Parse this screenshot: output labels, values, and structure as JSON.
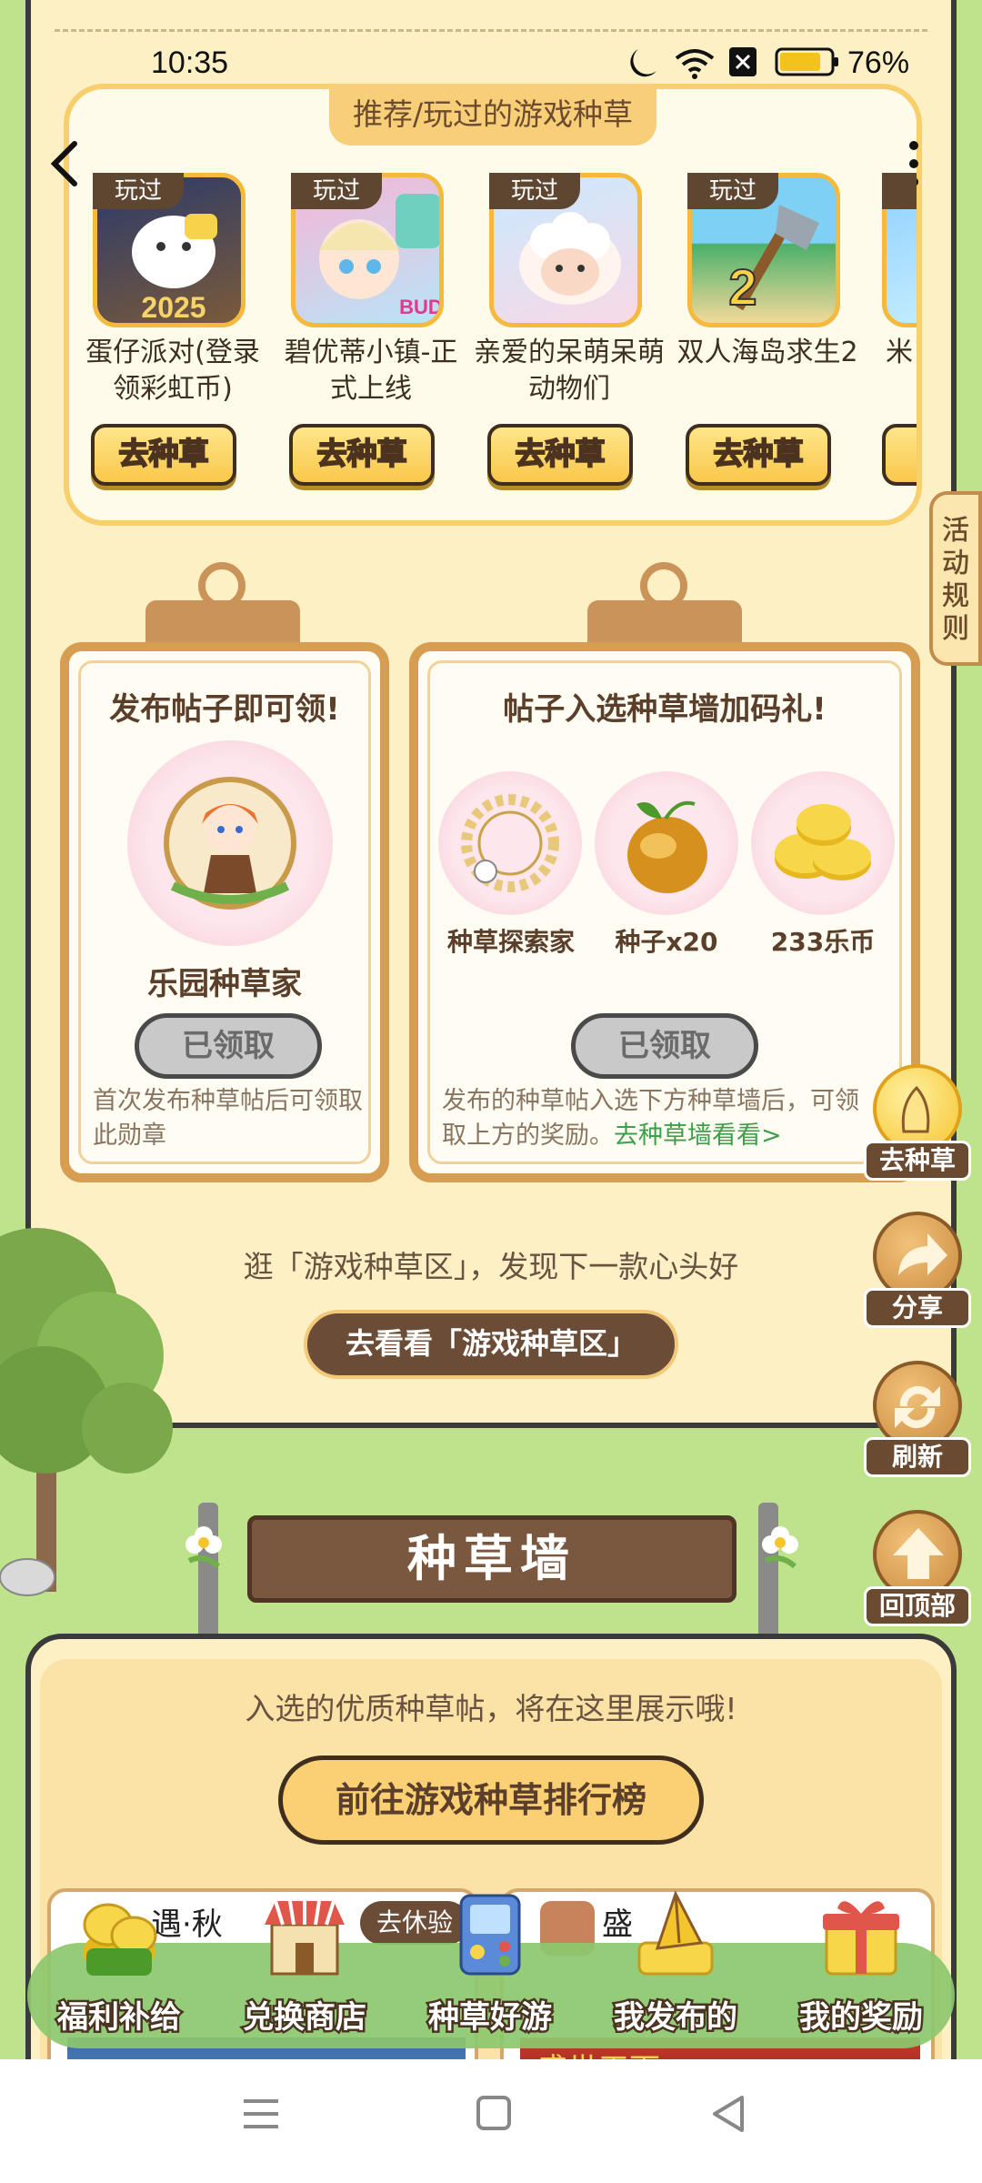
{
  "status_bar": {
    "time": "10:35",
    "battery": "76%"
  },
  "recommended": {
    "title": "推荐/玩过的游戏种草",
    "played_tag": "玩过",
    "go_label": "去种草",
    "games": [
      {
        "name": "蛋仔派对(登录领彩虹币)"
      },
      {
        "name": "碧优蒂小镇-正式上线"
      },
      {
        "name": "亲爱的呆萌呆萌动物们"
      },
      {
        "name": "双人海岛求生2"
      },
      {
        "name": "米"
      }
    ]
  },
  "rules_tab": {
    "label": "活动规则"
  },
  "reward_left": {
    "title": "发布帖子即可领!",
    "reward_name": "乐园种草家",
    "button": "已领取",
    "note": "首次发布种草帖后可领取此勋章"
  },
  "reward_right": {
    "title": "帖子入选种草墙加码礼!",
    "rewards": [
      "种草探索家",
      "种子x20",
      "233乐币"
    ],
    "button": "已领取",
    "note": "发布的种草帖入选下方种草墙后，可领取上方的奖励。",
    "link": "去种草墙看看>"
  },
  "float_buttons": [
    "去种草",
    "分享",
    "刷新",
    "回顶部"
  ],
  "explore": {
    "text": "逛「游戏种草区」，发现下一款心头好",
    "button": "去看看「游戏种草区」"
  },
  "wall": {
    "title": "种草墙",
    "desc": "入选的优质种草帖，将在这里展示哦!",
    "rank_button": "前往游戏种草排行榜"
  },
  "post_preview": {
    "left_title": "遇·秋",
    "left_chip": "去休验",
    "right_title": "盛",
    "right_banner": "盛世天下"
  },
  "bottom_nav": [
    "福利补给",
    "兑换商店",
    "种草好游",
    "我发布的",
    "我的奖励"
  ],
  "colors": {
    "cream": "#fdf0c4",
    "brown": "#6b4c37",
    "gold": "#f9c84a",
    "green": "#bfe38c"
  }
}
